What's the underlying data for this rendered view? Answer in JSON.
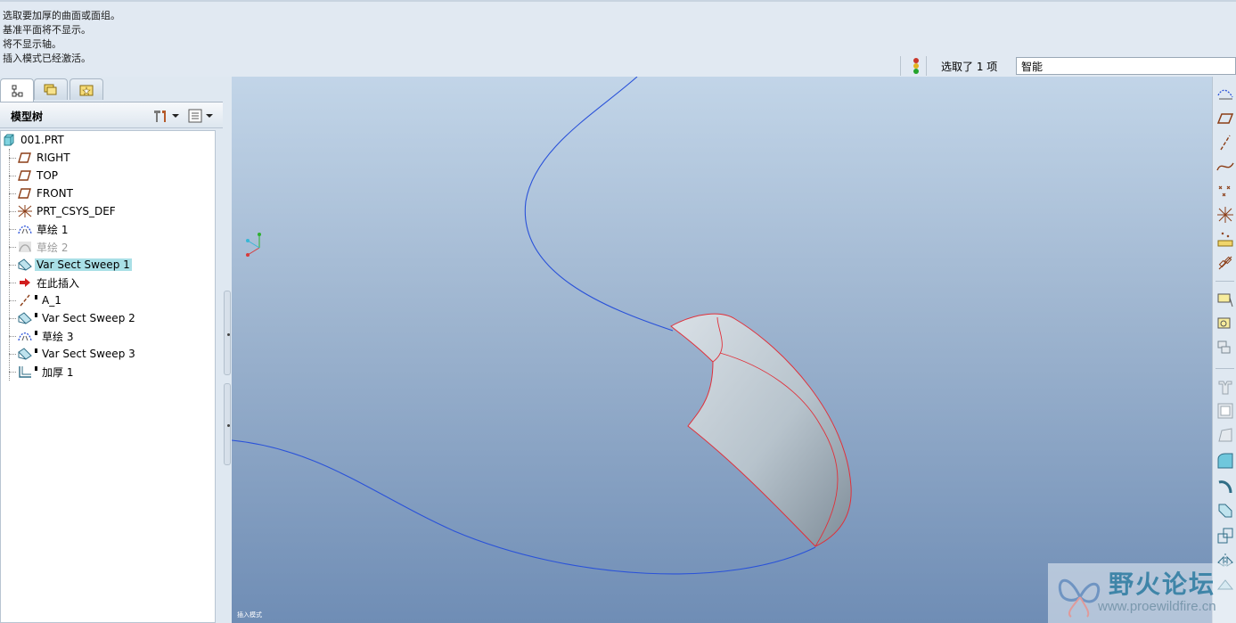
{
  "messages": [
    "选取要加厚的曲面或面组。",
    "基准平面将不显示。",
    "将不显示轴。",
    "插入模式已经激活。"
  ],
  "status": {
    "selected_text": "选取了 1 项",
    "filter_value": "智能",
    "icons": [
      "traffic-light-icon"
    ]
  },
  "left_panel": {
    "tabs": [
      {
        "name": "model-tree",
        "icon": "model-tree-icon"
      },
      {
        "name": "folder-browser",
        "icon": "folder-browser-icon"
      },
      {
        "name": "favorites",
        "icon": "favorites-icon"
      }
    ],
    "tree_title": "模型树",
    "tree_items": [
      {
        "label": "001.PRT",
        "icon": "part-icon"
      },
      {
        "label": "RIGHT",
        "icon": "datum-plane-icon"
      },
      {
        "label": "TOP",
        "icon": "datum-plane-icon"
      },
      {
        "label": "FRONT",
        "icon": "datum-plane-icon"
      },
      {
        "label": "PRT_CSYS_DEF",
        "icon": "csys-icon"
      },
      {
        "label": "草绘 1",
        "icon": "sketch-icon"
      },
      {
        "label": "草绘 2",
        "icon": "sketch-icon",
        "state": "suppressed"
      },
      {
        "label": "Var Sect Sweep 1",
        "icon": "sweep-icon",
        "state": "selected"
      },
      {
        "label": "在此插入",
        "icon": "insert-arrow-icon"
      },
      {
        "label": "A_1",
        "icon": "datum-axis-icon",
        "state": "after-insert"
      },
      {
        "label": "Var Sect Sweep 2",
        "icon": "sweep-icon",
        "state": "after-insert"
      },
      {
        "label": "草绘 3",
        "icon": "sketch-icon",
        "state": "after-insert"
      },
      {
        "label": "Var Sect Sweep 3",
        "icon": "sweep-icon",
        "state": "after-insert"
      },
      {
        "label": "加厚 1",
        "icon": "thicken-icon",
        "state": "after-insert"
      }
    ]
  },
  "viewport": {
    "mode_label": "插入模式",
    "colors": {
      "curve": "#2a52d9",
      "edge": "#e0303a",
      "surface": "#b9c4cd"
    }
  },
  "right_toolbar": [
    "sketch-tool-icon",
    "datum-plane-tool-icon",
    "datum-axis-tool-icon",
    "datum-curve-tool-icon",
    "datum-point-tool-icon",
    "csys-tool-icon",
    "analysis-feature-icon",
    "chain-icon",
    "extrude-icon",
    "revolve-icon",
    "sweep-tool-icon",
    "rib-icon",
    "shell-icon",
    "draft-icon",
    "round-icon",
    "chamfer-icon",
    "hole-icon",
    "pattern-icon",
    "mirror-icon",
    "merge-icon"
  ],
  "watermark": {
    "title": "野火论坛",
    "url": "www.proewildfire.cn"
  }
}
